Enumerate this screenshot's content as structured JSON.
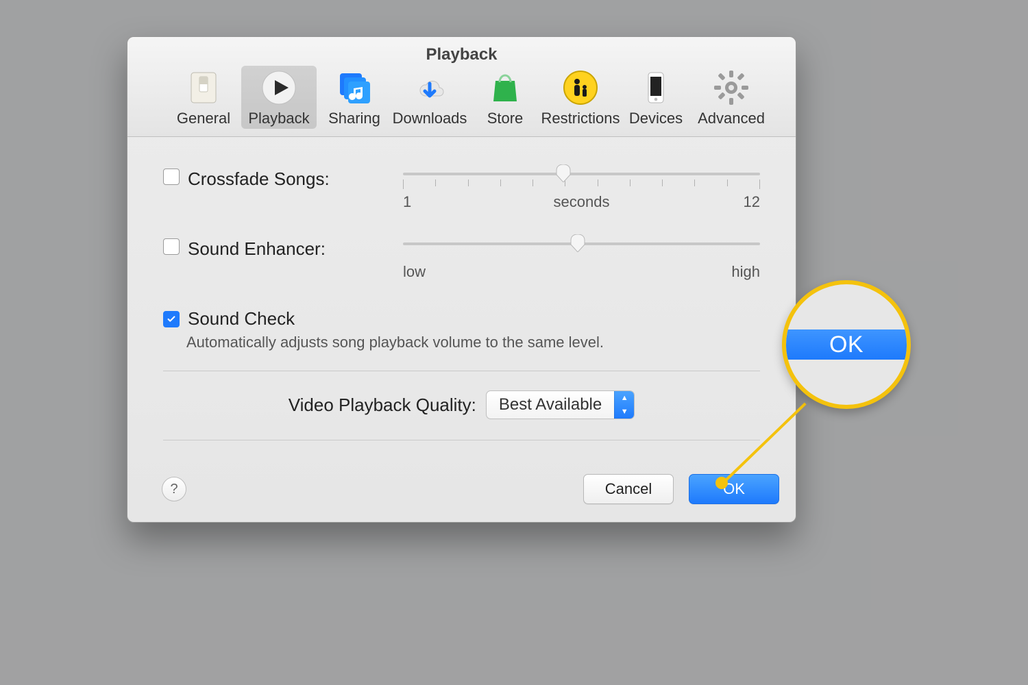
{
  "window": {
    "title": "Playback"
  },
  "tabs": [
    {
      "id": "general",
      "label": "General"
    },
    {
      "id": "playback",
      "label": "Playback",
      "selected": true
    },
    {
      "id": "sharing",
      "label": "Sharing"
    },
    {
      "id": "downloads",
      "label": "Downloads"
    },
    {
      "id": "store",
      "label": "Store"
    },
    {
      "id": "restrictions",
      "label": "Restrictions"
    },
    {
      "id": "devices",
      "label": "Devices"
    },
    {
      "id": "advanced",
      "label": "Advanced"
    }
  ],
  "crossfade": {
    "label": "Crossfade Songs:",
    "checked": false,
    "min_label": "1",
    "max_label": "12",
    "unit_label": "seconds",
    "value_percent": 45
  },
  "enhancer": {
    "label": "Sound Enhancer:",
    "checked": false,
    "min_label": "low",
    "max_label": "high",
    "value_percent": 49
  },
  "sound_check": {
    "label": "Sound Check",
    "checked": true,
    "description": "Automatically adjusts song playback volume to the same level."
  },
  "video_quality": {
    "label": "Video Playback Quality:",
    "selected": "Best Available"
  },
  "buttons": {
    "help": "?",
    "cancel": "Cancel",
    "ok": "OK"
  },
  "callout": {
    "text": "OK"
  },
  "colors": {
    "accent": "#1e7afc",
    "highlight": "#f4c20d"
  }
}
